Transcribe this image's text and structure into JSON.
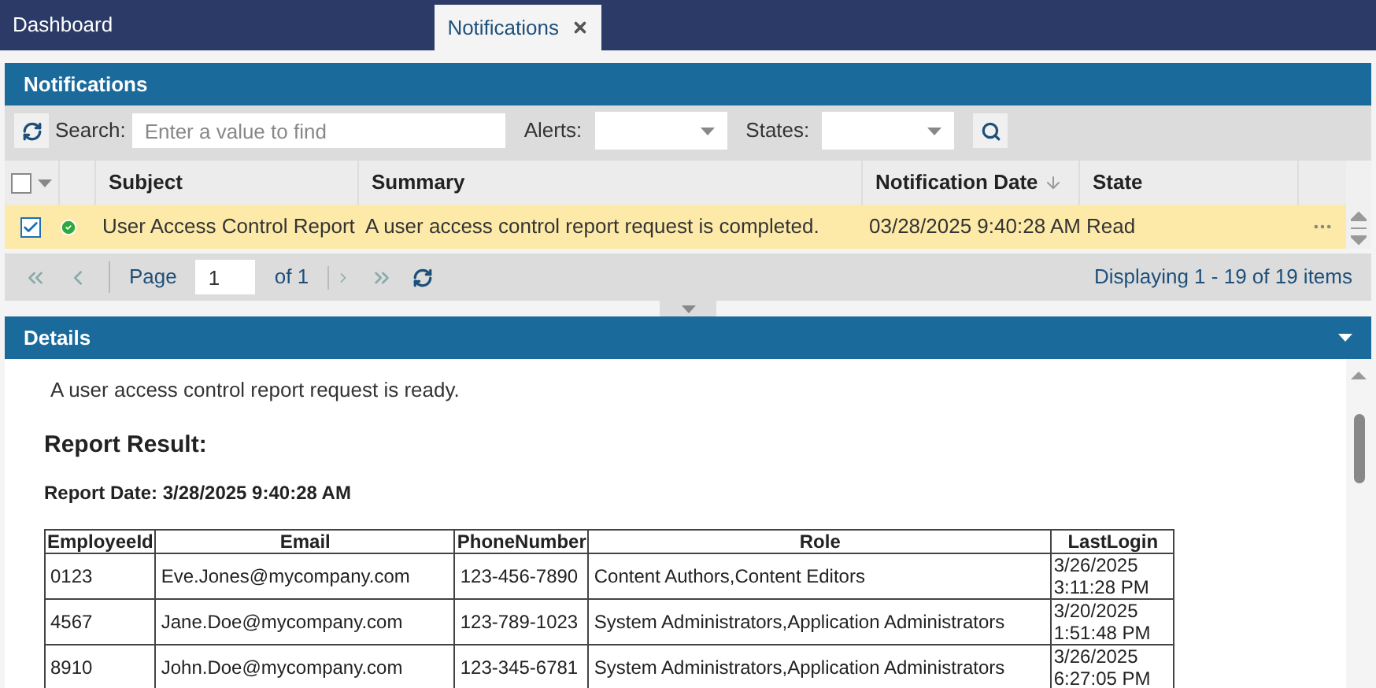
{
  "tabs": [
    {
      "label": "Dashboard",
      "selected": false,
      "closable": false
    },
    {
      "label": "Notifications",
      "selected": true,
      "closable": true
    }
  ],
  "panel": {
    "title": "Notifications"
  },
  "toolbar": {
    "search_label": "Search:",
    "search_placeholder": "Enter a value to find",
    "filters": [
      {
        "label": "Alerts:"
      },
      {
        "label": "States:"
      }
    ]
  },
  "grid": {
    "select_all_checked": false,
    "columns": [
      {
        "label": "Subject",
        "sorted": false
      },
      {
        "label": "Summary",
        "sorted": false
      },
      {
        "label": "Notification Date",
        "sorted": true
      },
      {
        "label": "State",
        "sorted": false
      }
    ],
    "rows": [
      {
        "checked": true,
        "selected": true,
        "completed": true,
        "subject": "User Access Control Report",
        "summary": "A user access control report request is completed.",
        "date": "03/28/2025 9:40:28 AM",
        "state": "Read"
      }
    ]
  },
  "pager": {
    "page_label": "Page",
    "page": "1",
    "of": "of 1",
    "summary": "Displaying 1 - 19 of 19 items"
  },
  "details": {
    "title": "Details",
    "message": "A user access control report request is ready.",
    "heading": "Report Result:",
    "report_date": "Report Date: 3/28/2025 9:40:28 AM",
    "table": {
      "columns": [
        "EmployeeId",
        "Email",
        "PhoneNumber",
        "Role",
        "LastLogin"
      ],
      "rows": [
        [
          "0123",
          "Eve.Jones@mycompany.com",
          "123-456-7890",
          "Content Authors,Content Editors",
          "3/26/2025 3:11:28 PM"
        ],
        [
          "4567",
          "Jane.Doe@mycompany.com",
          "123-789-1023",
          "System Administrators,Application Administrators",
          "3/20/2025 1:51:48 PM"
        ],
        [
          "8910",
          "John.Doe@mycompany.com",
          "123-345-6781",
          "System Administrators,Application Administrators",
          "3/26/2025 6:27:05 PM"
        ]
      ]
    }
  }
}
